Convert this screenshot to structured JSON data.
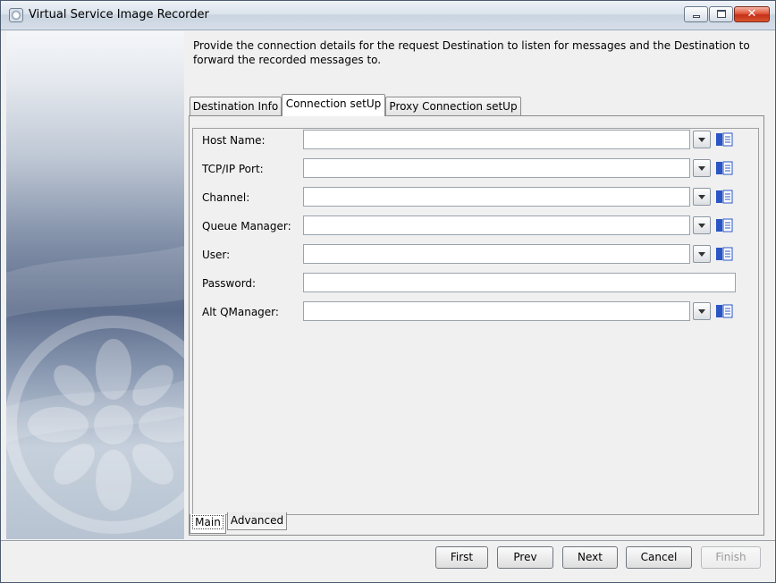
{
  "window": {
    "title": "Virtual Service Image Recorder"
  },
  "description": "Provide the connection details for the request Destination to listen for messages and the Destination to forward the recorded messages to.",
  "tabs": [
    {
      "label": "Destination Info",
      "active": false
    },
    {
      "label": "Connection setUp",
      "active": true
    },
    {
      "label": "Proxy Connection setUp",
      "active": false
    }
  ],
  "fields": [
    {
      "label": "Host Name:",
      "value": ""
    },
    {
      "label": "TCP/IP Port:",
      "value": ""
    },
    {
      "label": "Channel:",
      "value": ""
    },
    {
      "label": "Queue Manager:",
      "value": ""
    },
    {
      "label": "User:",
      "value": ""
    },
    {
      "label": "Password:",
      "value": ""
    },
    {
      "label": "Alt QManager:",
      "value": ""
    }
  ],
  "bottom_tabs": [
    {
      "label": "Main",
      "active": true
    },
    {
      "label": "Advanced",
      "active": false
    }
  ],
  "buttons": {
    "first": "First",
    "prev": "Prev",
    "next": "Next",
    "cancel": "Cancel",
    "finish": "Finish"
  },
  "icons": {
    "app": "app-icon",
    "dropdown": "chevron-down-icon",
    "properties": "properties-icon"
  },
  "colors": {
    "title_bar": "#dbe3ec",
    "close_button": "#c4301a",
    "sidebar_mid": "#5b6b8a",
    "properties_icon": "#2a56c6"
  }
}
